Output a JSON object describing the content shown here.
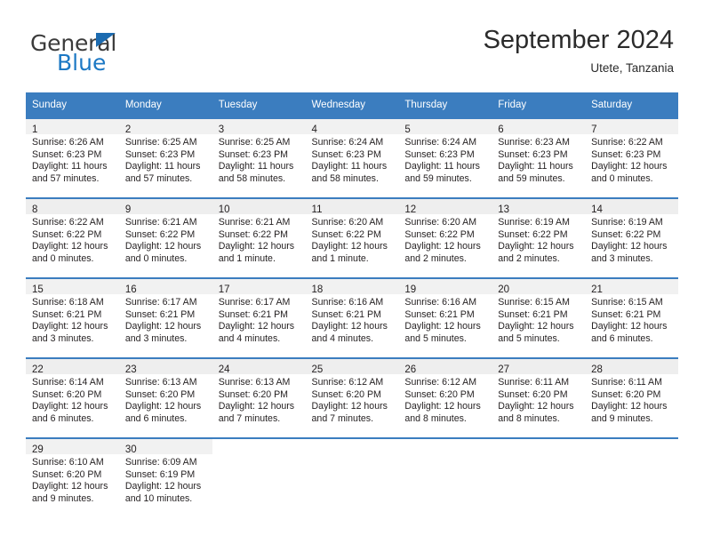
{
  "brand": {
    "name_part1": "General",
    "name_part2": "Blue",
    "triangle_color": "#1c6bb0",
    "blue_color": "#1c78c4"
  },
  "header": {
    "title": "September 2024",
    "subtitle": "Utete, Tanzania"
  },
  "theme": {
    "header_band": "#3b7dbf",
    "daynum_strip": "#f1f1f1",
    "text": "#231f20"
  },
  "weekdays": [
    "Sunday",
    "Monday",
    "Tuesday",
    "Wednesday",
    "Thursday",
    "Friday",
    "Saturday"
  ],
  "labels": {
    "sunrise_prefix": "Sunrise:",
    "sunset_prefix": "Sunset:",
    "daylight_prefix": "Daylight:"
  },
  "weeks": [
    [
      {
        "day": "1",
        "sunrise": "Sunrise: 6:26 AM",
        "sunset": "Sunset: 6:23 PM",
        "daylight_l1": "Daylight: 11 hours",
        "daylight_l2": "and 57 minutes."
      },
      {
        "day": "2",
        "sunrise": "Sunrise: 6:25 AM",
        "sunset": "Sunset: 6:23 PM",
        "daylight_l1": "Daylight: 11 hours",
        "daylight_l2": "and 57 minutes."
      },
      {
        "day": "3",
        "sunrise": "Sunrise: 6:25 AM",
        "sunset": "Sunset: 6:23 PM",
        "daylight_l1": "Daylight: 11 hours",
        "daylight_l2": "and 58 minutes."
      },
      {
        "day": "4",
        "sunrise": "Sunrise: 6:24 AM",
        "sunset": "Sunset: 6:23 PM",
        "daylight_l1": "Daylight: 11 hours",
        "daylight_l2": "and 58 minutes."
      },
      {
        "day": "5",
        "sunrise": "Sunrise: 6:24 AM",
        "sunset": "Sunset: 6:23 PM",
        "daylight_l1": "Daylight: 11 hours",
        "daylight_l2": "and 59 minutes."
      },
      {
        "day": "6",
        "sunrise": "Sunrise: 6:23 AM",
        "sunset": "Sunset: 6:23 PM",
        "daylight_l1": "Daylight: 11 hours",
        "daylight_l2": "and 59 minutes."
      },
      {
        "day": "7",
        "sunrise": "Sunrise: 6:22 AM",
        "sunset": "Sunset: 6:23 PM",
        "daylight_l1": "Daylight: 12 hours",
        "daylight_l2": "and 0 minutes."
      }
    ],
    [
      {
        "day": "8",
        "sunrise": "Sunrise: 6:22 AM",
        "sunset": "Sunset: 6:22 PM",
        "daylight_l1": "Daylight: 12 hours",
        "daylight_l2": "and 0 minutes."
      },
      {
        "day": "9",
        "sunrise": "Sunrise: 6:21 AM",
        "sunset": "Sunset: 6:22 PM",
        "daylight_l1": "Daylight: 12 hours",
        "daylight_l2": "and 0 minutes."
      },
      {
        "day": "10",
        "sunrise": "Sunrise: 6:21 AM",
        "sunset": "Sunset: 6:22 PM",
        "daylight_l1": "Daylight: 12 hours",
        "daylight_l2": "and 1 minute."
      },
      {
        "day": "11",
        "sunrise": "Sunrise: 6:20 AM",
        "sunset": "Sunset: 6:22 PM",
        "daylight_l1": "Daylight: 12 hours",
        "daylight_l2": "and 1 minute."
      },
      {
        "day": "12",
        "sunrise": "Sunrise: 6:20 AM",
        "sunset": "Sunset: 6:22 PM",
        "daylight_l1": "Daylight: 12 hours",
        "daylight_l2": "and 2 minutes."
      },
      {
        "day": "13",
        "sunrise": "Sunrise: 6:19 AM",
        "sunset": "Sunset: 6:22 PM",
        "daylight_l1": "Daylight: 12 hours",
        "daylight_l2": "and 2 minutes."
      },
      {
        "day": "14",
        "sunrise": "Sunrise: 6:19 AM",
        "sunset": "Sunset: 6:22 PM",
        "daylight_l1": "Daylight: 12 hours",
        "daylight_l2": "and 3 minutes."
      }
    ],
    [
      {
        "day": "15",
        "sunrise": "Sunrise: 6:18 AM",
        "sunset": "Sunset: 6:21 PM",
        "daylight_l1": "Daylight: 12 hours",
        "daylight_l2": "and 3 minutes."
      },
      {
        "day": "16",
        "sunrise": "Sunrise: 6:17 AM",
        "sunset": "Sunset: 6:21 PM",
        "daylight_l1": "Daylight: 12 hours",
        "daylight_l2": "and 3 minutes."
      },
      {
        "day": "17",
        "sunrise": "Sunrise: 6:17 AM",
        "sunset": "Sunset: 6:21 PM",
        "daylight_l1": "Daylight: 12 hours",
        "daylight_l2": "and 4 minutes."
      },
      {
        "day": "18",
        "sunrise": "Sunrise: 6:16 AM",
        "sunset": "Sunset: 6:21 PM",
        "daylight_l1": "Daylight: 12 hours",
        "daylight_l2": "and 4 minutes."
      },
      {
        "day": "19",
        "sunrise": "Sunrise: 6:16 AM",
        "sunset": "Sunset: 6:21 PM",
        "daylight_l1": "Daylight: 12 hours",
        "daylight_l2": "and 5 minutes."
      },
      {
        "day": "20",
        "sunrise": "Sunrise: 6:15 AM",
        "sunset": "Sunset: 6:21 PM",
        "daylight_l1": "Daylight: 12 hours",
        "daylight_l2": "and 5 minutes."
      },
      {
        "day": "21",
        "sunrise": "Sunrise: 6:15 AM",
        "sunset": "Sunset: 6:21 PM",
        "daylight_l1": "Daylight: 12 hours",
        "daylight_l2": "and 6 minutes."
      }
    ],
    [
      {
        "day": "22",
        "sunrise": "Sunrise: 6:14 AM",
        "sunset": "Sunset: 6:20 PM",
        "daylight_l1": "Daylight: 12 hours",
        "daylight_l2": "and 6 minutes."
      },
      {
        "day": "23",
        "sunrise": "Sunrise: 6:13 AM",
        "sunset": "Sunset: 6:20 PM",
        "daylight_l1": "Daylight: 12 hours",
        "daylight_l2": "and 6 minutes."
      },
      {
        "day": "24",
        "sunrise": "Sunrise: 6:13 AM",
        "sunset": "Sunset: 6:20 PM",
        "daylight_l1": "Daylight: 12 hours",
        "daylight_l2": "and 7 minutes."
      },
      {
        "day": "25",
        "sunrise": "Sunrise: 6:12 AM",
        "sunset": "Sunset: 6:20 PM",
        "daylight_l1": "Daylight: 12 hours",
        "daylight_l2": "and 7 minutes."
      },
      {
        "day": "26",
        "sunrise": "Sunrise: 6:12 AM",
        "sunset": "Sunset: 6:20 PM",
        "daylight_l1": "Daylight: 12 hours",
        "daylight_l2": "and 8 minutes."
      },
      {
        "day": "27",
        "sunrise": "Sunrise: 6:11 AM",
        "sunset": "Sunset: 6:20 PM",
        "daylight_l1": "Daylight: 12 hours",
        "daylight_l2": "and 8 minutes."
      },
      {
        "day": "28",
        "sunrise": "Sunrise: 6:11 AM",
        "sunset": "Sunset: 6:20 PM",
        "daylight_l1": "Daylight: 12 hours",
        "daylight_l2": "and 9 minutes."
      }
    ],
    [
      {
        "day": "29",
        "sunrise": "Sunrise: 6:10 AM",
        "sunset": "Sunset: 6:20 PM",
        "daylight_l1": "Daylight: 12 hours",
        "daylight_l2": "and 9 minutes."
      },
      {
        "day": "30",
        "sunrise": "Sunrise: 6:09 AM",
        "sunset": "Sunset: 6:19 PM",
        "daylight_l1": "Daylight: 12 hours",
        "daylight_l2": "and 10 minutes."
      },
      null,
      null,
      null,
      null,
      null
    ]
  ]
}
